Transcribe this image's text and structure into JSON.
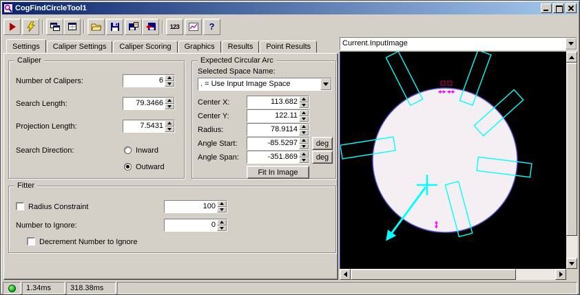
{
  "window": {
    "title": "CogFindCircleTool1"
  },
  "toolbar": {
    "num_button_label": "123"
  },
  "tabs": [
    {
      "label": "Settings"
    },
    {
      "label": "Caliper Settings"
    },
    {
      "label": "Caliper Scoring"
    },
    {
      "label": "Graphics"
    },
    {
      "label": "Results"
    },
    {
      "label": "Point Results"
    }
  ],
  "caliper": {
    "title": "Caliper",
    "number_of_calipers_label": "Number of Calipers:",
    "number_of_calipers_value": "6",
    "search_length_label": "Search Length:",
    "search_length_value": "79.3466",
    "projection_length_label": "Projection Length:",
    "projection_length_value": "7.5431",
    "search_direction_label": "Search Direction:",
    "inward_label": "Inward",
    "outward_label": "Outward",
    "selected_direction": "Outward"
  },
  "expected_arc": {
    "title": "Expected Circular Arc",
    "selected_space_label": "Selected Space Name:",
    "selected_space_value": ". = Use Input Image Space",
    "center_x_label": "Center X:",
    "center_x_value": "113.682",
    "center_y_label": "Center Y:",
    "center_y_value": "122.11",
    "radius_label": "Radius:",
    "radius_value": "78.9114",
    "angle_start_label": "Angle Start:",
    "angle_start_value": "-85.5297",
    "angle_span_label": "Angle Span:",
    "angle_span_value": "-351.869",
    "deg_label": "deg",
    "fit_in_image_label": "Fit In Image"
  },
  "fitter": {
    "title": "Fitter",
    "radius_constraint_label": "Radius Constraint",
    "radius_constraint_checked": false,
    "radius_constraint_value": "100",
    "number_to_ignore_label": "Number to Ignore:",
    "number_to_ignore_value": "0",
    "decrement_label": "Decrement Number to Ignore",
    "decrement_checked": false
  },
  "image_panel": {
    "source_selector_value": "Current.InputImage"
  },
  "statusbar": {
    "execution_time": "1.34ms",
    "total_time": "318.38ms"
  },
  "colors": {
    "caliper_overlay": "#00ffff",
    "circle_outline": "#5050c8",
    "marker": "#ff00ff",
    "status_led": "#00a400",
    "titlebar_left": "#0a246a",
    "titlebar_right": "#a6caf0"
  }
}
